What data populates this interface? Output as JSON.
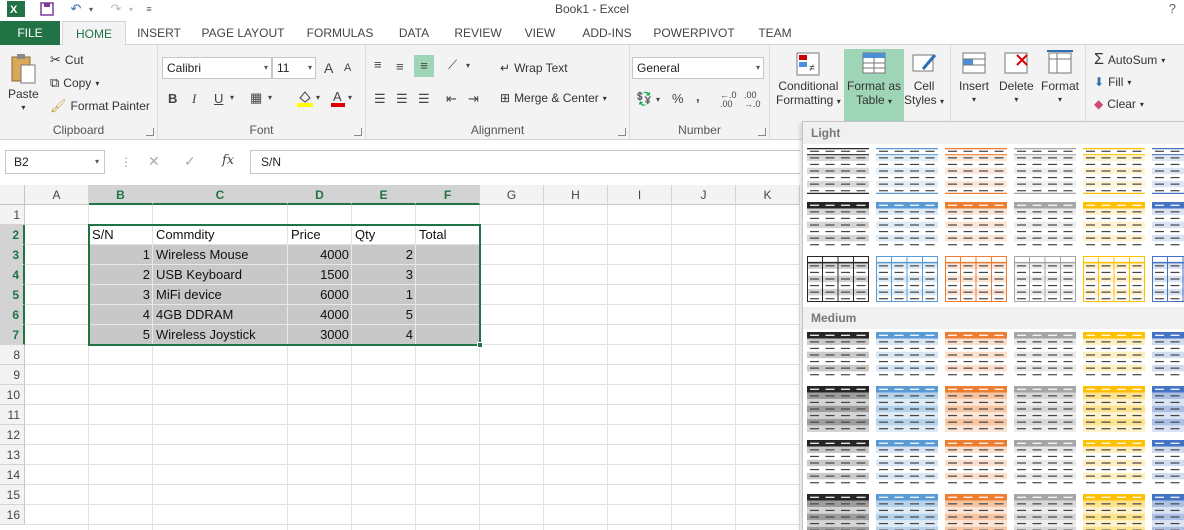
{
  "window": {
    "title": "Book1 - Excel",
    "help": "?"
  },
  "tabs": [
    "FILE",
    "HOME",
    "INSERT",
    "PAGE LAYOUT",
    "FORMULAS",
    "DATA",
    "REVIEW",
    "VIEW",
    "ADD-INS",
    "POWERPIVOT",
    "TEAM"
  ],
  "ribbon": {
    "clipboard": {
      "paste": "Paste",
      "cut": "Cut",
      "copy": "Copy",
      "format_painter": "Format Painter",
      "label": "Clipboard"
    },
    "font": {
      "name": "Calibri",
      "size": "11",
      "bold": "B",
      "italic": "I",
      "underline": "U",
      "grow": "A",
      "shrink": "A",
      "label": "Font"
    },
    "alignment": {
      "wrap": "Wrap Text",
      "merge": "Merge & Center",
      "label": "Alignment"
    },
    "number": {
      "format": "General",
      "percent": "%",
      "comma": ",",
      "inc_dec": ".00\n→.0",
      "label": "Number"
    },
    "styles": {
      "conditional": "Conditional",
      "conditional2": "Formatting",
      "format_table": "Format as",
      "format_table2": "Table",
      "cell_styles": "Cell",
      "cell_styles2": "Styles"
    },
    "cells": {
      "insert": "Insert",
      "delete": "Delete",
      "format": "Format"
    },
    "editing": {
      "autosum": "AutoSum",
      "fill": "Fill",
      "clear": "Clear"
    }
  },
  "formula_bar": {
    "name_box": "B2",
    "fx": "fx",
    "value": "S/N"
  },
  "columns": [
    "A",
    "B",
    "C",
    "D",
    "E",
    "F",
    "G",
    "H",
    "I",
    "J",
    "K"
  ],
  "rows": [
    "1",
    "2",
    "3",
    "4",
    "5",
    "6",
    "7",
    "8",
    "9",
    "10",
    "11",
    "12",
    "13",
    "14",
    "15",
    "16"
  ],
  "table": {
    "headers": [
      "S/N",
      "Commdity",
      "Price",
      "Qty",
      "Total"
    ],
    "rows": [
      [
        "1",
        "Wireless Mouse",
        "4000",
        "2",
        ""
      ],
      [
        "2",
        "USB Keyboard",
        "1500",
        "3",
        ""
      ],
      [
        "3",
        "MiFi device",
        "6000",
        "1",
        ""
      ],
      [
        "4",
        "4GB DDRAM",
        "4000",
        "5",
        ""
      ],
      [
        "5",
        "Wireless Joystick",
        "3000",
        "4",
        ""
      ]
    ]
  },
  "gallery": {
    "light_label": "Light",
    "medium_label": "Medium",
    "colors": {
      "black": "#262626",
      "blue": "#5b9bd5",
      "orange": "#ed7d31",
      "gray": "#a5a5a5",
      "gold": "#ffc000",
      "navy": "#4472c4"
    }
  },
  "colors": {
    "accent": "#217346",
    "selection_fill": "#c8c8c8"
  }
}
